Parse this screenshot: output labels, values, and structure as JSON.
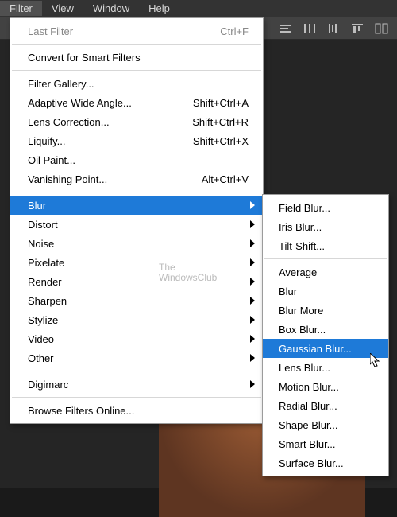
{
  "menubar": {
    "items": [
      "Filter",
      "View",
      "Window",
      "Help"
    ],
    "active_index": 0
  },
  "menu": {
    "sections": [
      [
        {
          "label": "Last Filter",
          "shortcut": "Ctrl+F",
          "disabled": true
        }
      ],
      [
        {
          "label": "Convert for Smart Filters"
        }
      ],
      [
        {
          "label": "Filter Gallery..."
        },
        {
          "label": "Adaptive Wide Angle...",
          "shortcut": "Shift+Ctrl+A"
        },
        {
          "label": "Lens Correction...",
          "shortcut": "Shift+Ctrl+R"
        },
        {
          "label": "Liquify...",
          "shortcut": "Shift+Ctrl+X"
        },
        {
          "label": "Oil Paint..."
        },
        {
          "label": "Vanishing Point...",
          "shortcut": "Alt+Ctrl+V"
        }
      ],
      [
        {
          "label": "Blur",
          "submenu": true,
          "hover": true
        },
        {
          "label": "Distort",
          "submenu": true
        },
        {
          "label": "Noise",
          "submenu": true
        },
        {
          "label": "Pixelate",
          "submenu": true
        },
        {
          "label": "Render",
          "submenu": true
        },
        {
          "label": "Sharpen",
          "submenu": true
        },
        {
          "label": "Stylize",
          "submenu": true
        },
        {
          "label": "Video",
          "submenu": true
        },
        {
          "label": "Other",
          "submenu": true
        }
      ],
      [
        {
          "label": "Digimarc",
          "submenu": true
        }
      ],
      [
        {
          "label": "Browse Filters Online..."
        }
      ]
    ]
  },
  "submenu": {
    "sections": [
      [
        {
          "label": "Field Blur..."
        },
        {
          "label": "Iris Blur..."
        },
        {
          "label": "Tilt-Shift..."
        }
      ],
      [
        {
          "label": "Average"
        },
        {
          "label": "Blur"
        },
        {
          "label": "Blur More"
        },
        {
          "label": "Box Blur..."
        },
        {
          "label": "Gaussian Blur...",
          "hover": true
        },
        {
          "label": "Lens Blur..."
        },
        {
          "label": "Motion Blur..."
        },
        {
          "label": "Radial Blur..."
        },
        {
          "label": "Shape Blur..."
        },
        {
          "label": "Smart Blur..."
        },
        {
          "label": "Surface Blur..."
        }
      ]
    ]
  },
  "watermark": {
    "line1": "The",
    "line2": "WindowsClub"
  },
  "toolbar_icons": [
    "align-icon",
    "distribute-h-icon",
    "distribute-v-icon",
    "align-top-icon",
    "panels-icon"
  ]
}
